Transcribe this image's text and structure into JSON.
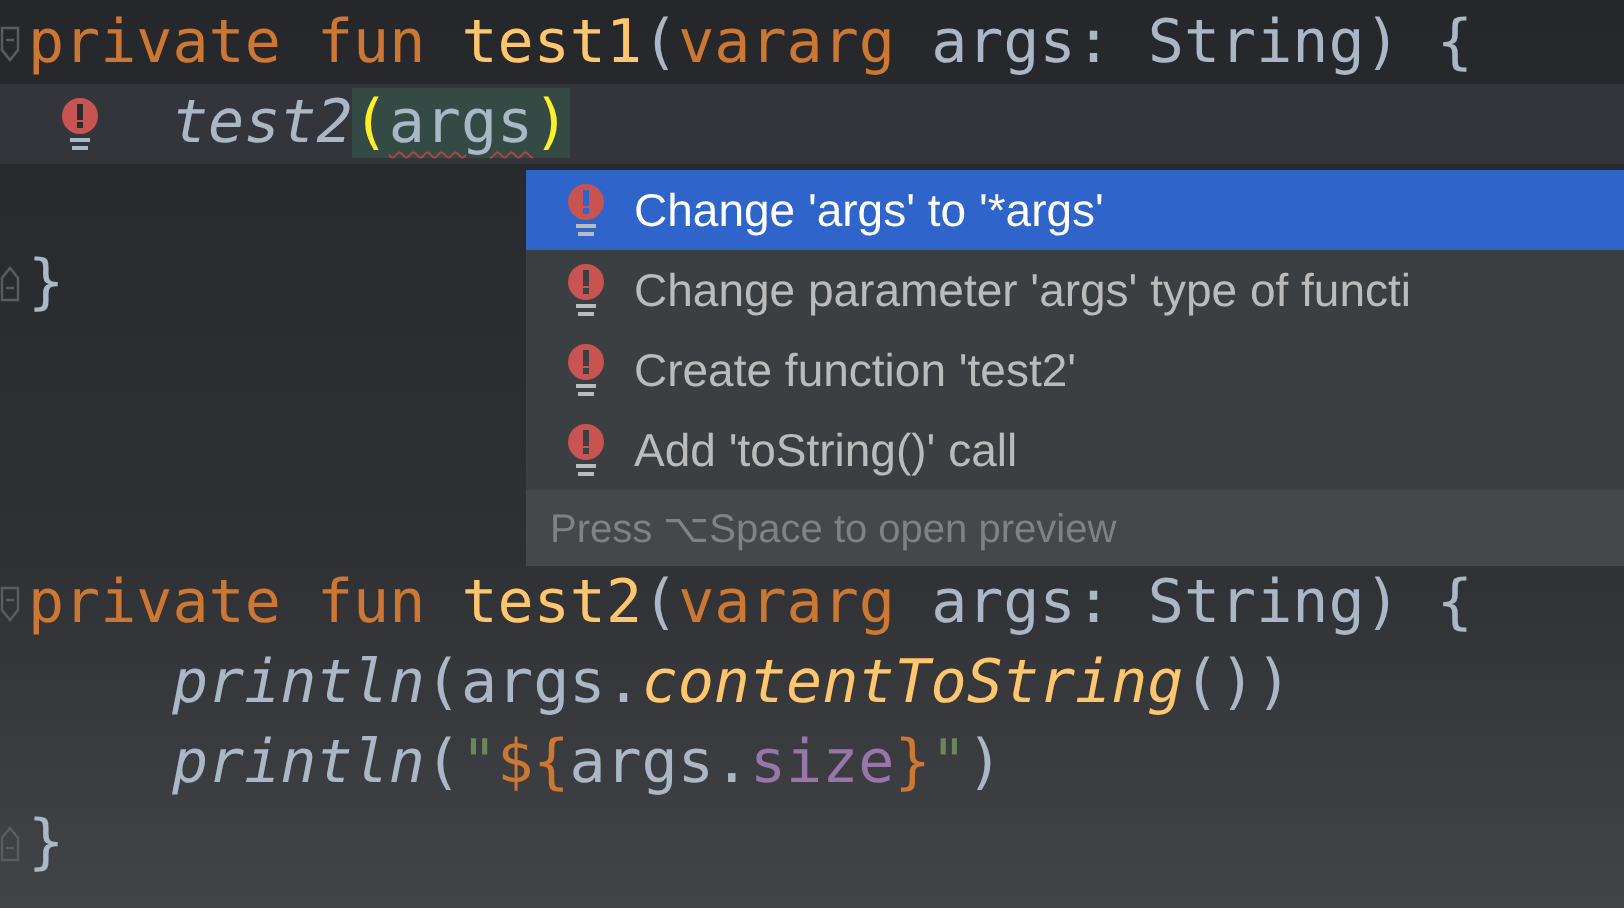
{
  "editor": {
    "lines": [
      {
        "kind": "code",
        "gutter": {
          "kind": "fold-start"
        },
        "tokens": [
          {
            "kind": "keyword",
            "text": "private fun "
          },
          {
            "kind": "fn-name",
            "text": "test1"
          },
          {
            "kind": "plain",
            "text": "("
          },
          {
            "kind": "keyword",
            "text": "vararg "
          },
          {
            "kind": "plain",
            "text": "args: String) {"
          }
        ]
      },
      {
        "kind": "indented-code",
        "gutter": {
          "kind": "bulb"
        },
        "current": true,
        "tokens": [
          {
            "kind": "call",
            "text": "test2"
          },
          {
            "kind": "brace-match",
            "text": "("
          },
          {
            "kind": "error",
            "text": "args"
          },
          {
            "kind": "brace-match",
            "text": ")"
          }
        ]
      },
      {
        "kind": "blank"
      },
      {
        "kind": "code",
        "gutter": {
          "kind": "fold-end"
        },
        "tokens": [
          {
            "kind": "plain",
            "text": "}"
          }
        ]
      },
      {
        "kind": "blank"
      },
      {
        "kind": "blank"
      },
      {
        "kind": "blank"
      },
      {
        "kind": "code",
        "gutter": {
          "kind": "fold-start"
        },
        "tokens": [
          {
            "kind": "keyword",
            "text": "private fun "
          },
          {
            "kind": "fn-name",
            "text": "test2"
          },
          {
            "kind": "plain",
            "text": "("
          },
          {
            "kind": "keyword",
            "text": "vararg "
          },
          {
            "kind": "plain",
            "text": "args: String) {"
          }
        ]
      },
      {
        "kind": "indented-code",
        "tokens": [
          {
            "kind": "call",
            "text": "println"
          },
          {
            "kind": "plain",
            "text": "(args."
          },
          {
            "kind": "ext-call",
            "text": "contentToString"
          },
          {
            "kind": "plain",
            "text": "())"
          }
        ]
      },
      {
        "kind": "indented-code",
        "tokens": [
          {
            "kind": "call",
            "text": "println"
          },
          {
            "kind": "plain",
            "text": "("
          },
          {
            "kind": "string",
            "text": "\""
          },
          {
            "kind": "template",
            "text": "${"
          },
          {
            "kind": "plain",
            "text": "args."
          },
          {
            "kind": "property",
            "text": "size"
          },
          {
            "kind": "template",
            "text": "}"
          },
          {
            "kind": "string",
            "text": "\""
          },
          {
            "kind": "plain",
            "text": ")"
          }
        ]
      },
      {
        "kind": "code",
        "gutter": {
          "kind": "fold-end"
        },
        "tokens": [
          {
            "kind": "plain",
            "text": "}"
          }
        ]
      }
    ]
  },
  "popup": {
    "items": [
      {
        "label": "Change 'args' to '*args'",
        "selected": true
      },
      {
        "label": "Change parameter 'args' type of functi",
        "selected": false
      },
      {
        "label": "Create function 'test2'",
        "selected": false
      },
      {
        "label": "Add 'toString()' call",
        "selected": false
      }
    ],
    "hint": "Press ⌥Space to open preview"
  }
}
